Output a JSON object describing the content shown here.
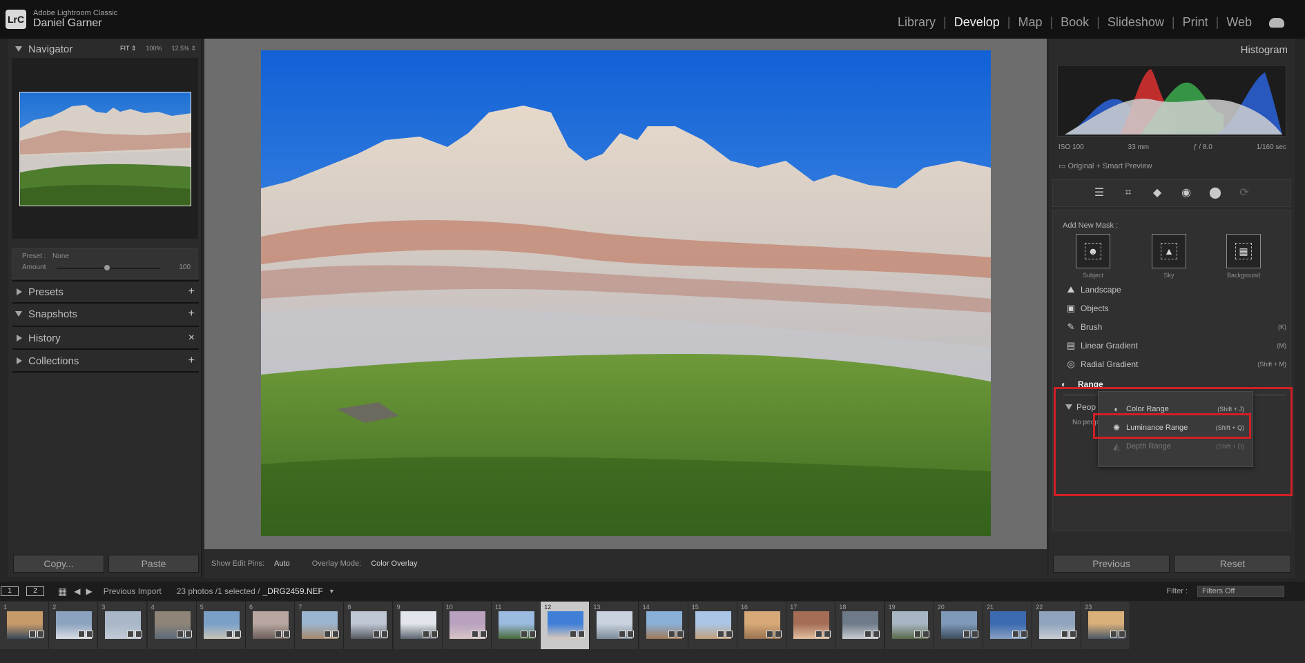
{
  "topbar": {
    "app_name": "Adobe Lightroom Classic",
    "user_name": "Daniel Garner",
    "logo": "LrC",
    "modules": [
      "Library",
      "Develop",
      "Map",
      "Book",
      "Slideshow",
      "Print",
      "Web"
    ],
    "active_module": "Develop"
  },
  "left_panel": {
    "navigator": {
      "title": "Navigator",
      "zoom": [
        "FIT ⇕",
        "100%",
        "12.5% ⇕"
      ]
    },
    "preset": {
      "label": "Preset :",
      "value": "None",
      "amount_label": "Amount",
      "amount_value": "100"
    },
    "sections": [
      {
        "title": "Presets",
        "action": "+"
      },
      {
        "title": "Snapshots",
        "action": "+"
      },
      {
        "title": "History",
        "action": "×"
      },
      {
        "title": "Collections",
        "action": "+"
      }
    ],
    "copy_button": "Copy...",
    "paste_button": "Paste"
  },
  "center_toolbar": {
    "edit_pins_label": "Show Edit Pins:",
    "edit_pins_value": "Auto",
    "overlay_label": "Overlay Mode:",
    "overlay_value": "Color Overlay"
  },
  "right_panel": {
    "histogram": {
      "title": "Histogram",
      "iso": "ISO 100",
      "focal": "33 mm",
      "aperture": "ƒ / 8.0",
      "shutter": "1/160 sec"
    },
    "smart_preview": "Original + Smart Preview",
    "add_new_mask": "Add New Mask :",
    "mask_tiles": [
      "Subject",
      "Sky",
      "Background"
    ],
    "mask_tools": [
      {
        "label": "Landscape",
        "key": ""
      },
      {
        "label": "Objects",
        "key": ""
      },
      {
        "label": "Brush",
        "key": "(K)"
      },
      {
        "label": "Linear Gradient",
        "key": "(M)"
      },
      {
        "label": "Radial Gradient",
        "key": "(Shift + M)"
      }
    ],
    "range_label": "Range",
    "people_label": "Peop",
    "no_people": "No peop",
    "range_menu": [
      {
        "label": "Color Range",
        "key": "(Shift + J)"
      },
      {
        "label": "Luminance Range",
        "key": "(Shift + Q)"
      },
      {
        "label": "Depth Range",
        "key": "(Shift + D)"
      }
    ],
    "previous_button": "Previous",
    "reset_button": "Reset"
  },
  "filmstrip_bar": {
    "monitor1": "1",
    "monitor2": "2",
    "source": "Previous Import",
    "count": "23 photos /1 selected /",
    "filename": "_DRG2459.NEF",
    "filter_label": "Filter :",
    "filter_value": "Filters Off"
  },
  "filmstrip": {
    "numbers": [
      "1",
      "2",
      "3",
      "4",
      "5",
      "6",
      "7",
      "8",
      "9",
      "10",
      "11",
      "12",
      "13",
      "14",
      "15",
      "16",
      "17",
      "18",
      "19",
      "20",
      "21",
      "22",
      "23"
    ],
    "selected": "12"
  }
}
